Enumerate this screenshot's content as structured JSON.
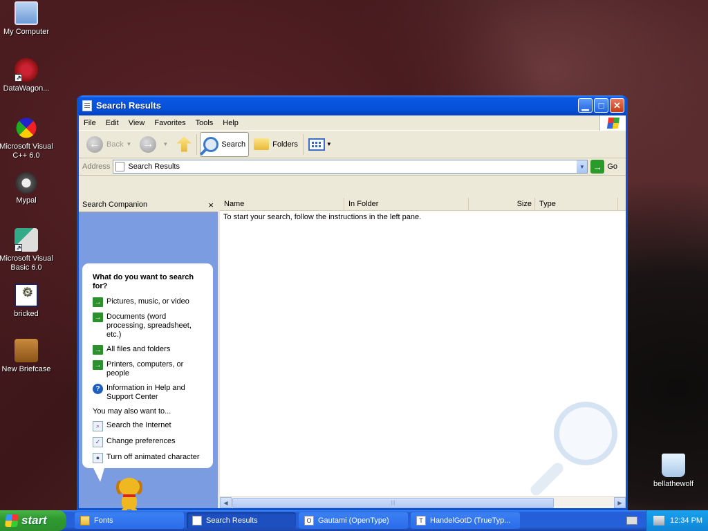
{
  "desktop": {
    "icons": [
      {
        "label": "My Computer",
        "icon": "my-computer-icon"
      },
      {
        "label": "DataWagon...",
        "icon": "datawagon-icon"
      },
      {
        "label": "Microsoft Visual C++ 6.0",
        "icon": "visual-cpp-icon"
      },
      {
        "label": "Mypal",
        "icon": "mypal-icon"
      },
      {
        "label": "Microsoft Visual Basic 6.0",
        "icon": "visual-basic-icon"
      },
      {
        "label": "bricked",
        "icon": "bricked-icon"
      },
      {
        "label": "New Briefcase",
        "icon": "briefcase-icon"
      },
      {
        "label": "bellathewolf",
        "icon": "recycle-bin-icon"
      }
    ]
  },
  "window": {
    "title": "Search Results",
    "menu": [
      "File",
      "Edit",
      "View",
      "Favorites",
      "Tools",
      "Help"
    ],
    "toolbar": {
      "back": "Back",
      "search": "Search",
      "folders": "Folders"
    },
    "address": {
      "label": "Address",
      "value": "Search Results",
      "go": "Go"
    },
    "search_companion": {
      "header": "Search Companion",
      "close": "×",
      "question": "What do you want to search for?",
      "options": [
        "Pictures, music, or video",
        "Documents (word processing, spreadsheet, etc.)",
        "All files and folders",
        "Printers, computers, or people",
        "Information in Help and Support Center"
      ],
      "also_label": "You may also want to...",
      "also_options": [
        "Search the Internet",
        "Change preferences",
        "Turn off animated character"
      ]
    },
    "results": {
      "columns": [
        "Name",
        "In Folder",
        "Size",
        "Type"
      ],
      "message": "To start your search, follow the instructions in the left pane."
    }
  },
  "taskbar": {
    "start": "start",
    "tasks": [
      {
        "label": "Fonts",
        "active": false
      },
      {
        "label": "Search Results",
        "active": true
      },
      {
        "label": "Gautami (OpenType)",
        "active": false
      },
      {
        "label": "HandelGotD (TrueTyp...",
        "active": false
      }
    ],
    "clock": "12:34 PM"
  },
  "colors": {
    "xp_blue": "#0a53d8",
    "companion_blue": "#7b9ce0",
    "start_green": "#2f9b2f"
  }
}
